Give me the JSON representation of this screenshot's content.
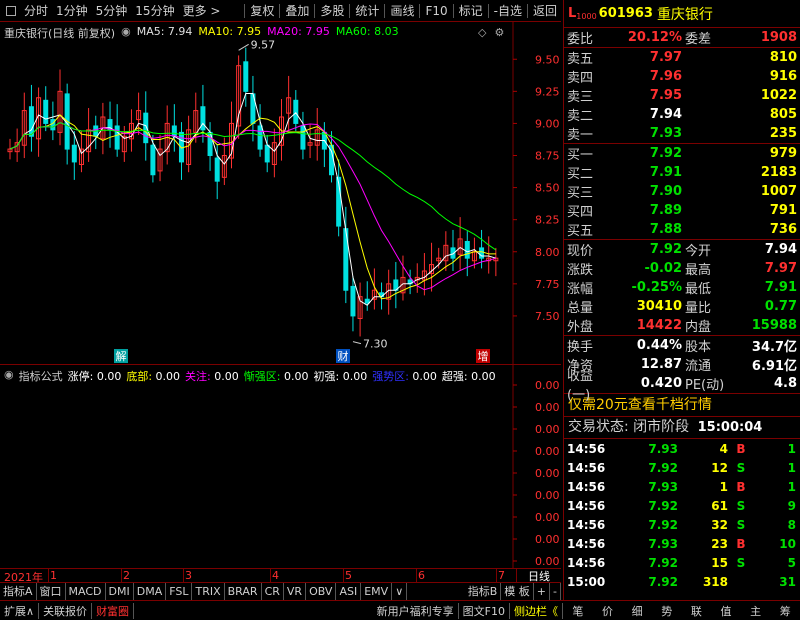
{
  "toolbar": {
    "items": [
      "分时",
      "1分钟",
      "5分钟",
      "15分钟",
      "更多 >"
    ],
    "right_items": [
      "复权",
      "叠加",
      "多股",
      "统计",
      "画线",
      "F10",
      "标记",
      "-自选",
      "返回"
    ]
  },
  "chart": {
    "stock_name": "重庆银行(日线 前复权)",
    "ma5": "MA5: 7.94",
    "ma10": "MA10: 7.95",
    "ma20": "MA20: 7.95",
    "ma60": "MA60: 8.03",
    "high_label": "9.57",
    "low_label": "7.30",
    "markers": [
      "解",
      "财",
      "增"
    ],
    "colors": {
      "up": "#ff3030",
      "down": "#00e0e0",
      "ma5": "#ffffff",
      "ma10": "#ffff00",
      "ma20": "#ff00ff",
      "ma60": "#00ff00"
    }
  },
  "chart_data": {
    "type": "candlestick",
    "y_ticks": [
      "9.50",
      "9.25",
      "9.00",
      "8.75",
      "8.50",
      "8.25",
      "8.00",
      "7.75",
      "7.50"
    ],
    "ylim": [
      7.25,
      9.65
    ],
    "closes": [
      8.8,
      8.85,
      9.1,
      8.9,
      9.2,
      9.0,
      8.95,
      9.25,
      8.8,
      8.7,
      8.8,
      8.95,
      8.9,
      9.05,
      8.95,
      8.8,
      8.9,
      9.0,
      9.1,
      8.85,
      8.6,
      8.8,
      9.0,
      8.9,
      8.7,
      8.95,
      9.1,
      8.95,
      8.75,
      8.55,
      8.75,
      9.0,
      9.45,
      9.25,
      9.0,
      8.8,
      8.7,
      8.85,
      9.05,
      9.2,
      9.0,
      8.8,
      8.85,
      8.95,
      8.8,
      8.6,
      8.2,
      7.7,
      7.5,
      7.65,
      7.6,
      7.7,
      7.65,
      7.75,
      7.7,
      7.8,
      7.75,
      7.8,
      7.85,
      7.9,
      7.95,
      8.05,
      7.95,
      8.1,
      7.95,
      8.0,
      7.95,
      7.95,
      7.95
    ],
    "volume_lower": {
      "y_ticks": [
        "0.00",
        "0.00",
        "0.00",
        "0.00",
        "0.00",
        "0.00",
        "0.00",
        "0.00",
        "0.00"
      ]
    }
  },
  "indicator": {
    "label": "指标公式",
    "items": [
      {
        "name": "涨停:",
        "value": "0.00",
        "color": "#ffffff"
      },
      {
        "name": "底部:",
        "value": "0.00",
        "color": "#ffff00"
      },
      {
        "name": "关注:",
        "value": "0.00",
        "color": "#ff00ff"
      },
      {
        "name": "惭强区:",
        "value": "0.00",
        "color": "#00ff00"
      },
      {
        "name": "初强:",
        "value": "0.00",
        "color": "#ffffff"
      },
      {
        "name": "强势区:",
        "value": "0.00",
        "color": "#3030ff"
      },
      {
        "name": "超强:",
        "value": "0.00",
        "color": "#ffffff"
      }
    ]
  },
  "time_axis": {
    "labels": [
      "2021年",
      "1",
      "2",
      "3",
      "4",
      "5",
      "6",
      "7"
    ],
    "day_label": "日线"
  },
  "ind_tabs": [
    "指标A",
    "窗口",
    "MACD",
    "DMI",
    "DMA",
    "FSL",
    "TRIX",
    "BRAR",
    "CR",
    "VR",
    "OBV",
    "ASI",
    "EMV",
    "∨",
    "指标B",
    "模 板",
    "+",
    "-"
  ],
  "bottom_bar": {
    "left": [
      "扩展∧",
      "关联报价",
      "财富圈"
    ],
    "mid": [
      "新用户福利专享",
      "图文F10",
      "侧边栏《"
    ],
    "right": [
      "笔",
      "价",
      "细",
      "势",
      "联",
      "值",
      "主",
      "筹"
    ]
  },
  "quote": {
    "prefix": "L",
    "prefix_sub": "1000",
    "code": "601963",
    "name": "重庆银行",
    "weibi_label": "委比",
    "weibi": "20.12%",
    "weicha_label": "委差",
    "weicha": "1908",
    "asks": [
      {
        "label": "卖五",
        "price": "7.97",
        "vol": "810",
        "color": "red"
      },
      {
        "label": "卖四",
        "price": "7.96",
        "vol": "916",
        "color": "red"
      },
      {
        "label": "卖三",
        "price": "7.95",
        "vol": "1022",
        "color": "red"
      },
      {
        "label": "卖二",
        "price": "7.94",
        "vol": "805",
        "color": "white"
      },
      {
        "label": "卖一",
        "price": "7.93",
        "vol": "235",
        "color": "green"
      }
    ],
    "bids": [
      {
        "label": "买一",
        "price": "7.92",
        "vol": "979",
        "color": "green"
      },
      {
        "label": "买二",
        "price": "7.91",
        "vol": "2183",
        "color": "green"
      },
      {
        "label": "买三",
        "price": "7.90",
        "vol": "1007",
        "color": "green"
      },
      {
        "label": "买四",
        "price": "7.89",
        "vol": "791",
        "color": "green"
      },
      {
        "label": "买五",
        "price": "7.88",
        "vol": "736",
        "color": "green"
      }
    ],
    "stats": [
      {
        "l1": "现价",
        "v1": "7.92",
        "c1": "green",
        "l2": "今开",
        "v2": "7.94",
        "c2": "white"
      },
      {
        "l1": "涨跌",
        "v1": "-0.02",
        "c1": "green",
        "l2": "最高",
        "v2": "7.97",
        "c2": "red"
      },
      {
        "l1": "涨幅",
        "v1": "-0.25%",
        "c1": "green",
        "l2": "最低",
        "v2": "7.91",
        "c2": "green"
      },
      {
        "l1": "总量",
        "v1": "30410",
        "c1": "yellow",
        "l2": "量比",
        "v2": "0.77",
        "c2": "green"
      },
      {
        "l1": "外盘",
        "v1": "14422",
        "c1": "red",
        "l2": "内盘",
        "v2": "15988",
        "c2": "green"
      }
    ],
    "fund": [
      {
        "l1": "换手",
        "v1": "0.44%",
        "l2": "股本",
        "v2": "34.7亿"
      },
      {
        "l1": "净资",
        "v1": "12.87",
        "l2": "流通",
        "v2": "6.91亿"
      },
      {
        "l1": "收益(一)",
        "v1": "0.420",
        "l2": "PE(动)",
        "v2": "4.8"
      }
    ],
    "promo": "仅需20元查看千档行情",
    "status_label": "交易状态: 闭市阶段",
    "status_time": "15:00:04",
    "ticks": [
      {
        "t": "14:56",
        "p": "7.93",
        "pc": "green",
        "v": "4",
        "bs": "B",
        "bsc": "red",
        "n": "1"
      },
      {
        "t": "14:56",
        "p": "7.92",
        "pc": "green",
        "v": "12",
        "bs": "S",
        "bsc": "green",
        "n": "1"
      },
      {
        "t": "14:56",
        "p": "7.93",
        "pc": "green",
        "v": "1",
        "bs": "B",
        "bsc": "red",
        "n": "1"
      },
      {
        "t": "14:56",
        "p": "7.92",
        "pc": "green",
        "v": "61",
        "bs": "S",
        "bsc": "green",
        "n": "9"
      },
      {
        "t": "14:56",
        "p": "7.92",
        "pc": "green",
        "v": "32",
        "bs": "S",
        "bsc": "green",
        "n": "8"
      },
      {
        "t": "14:56",
        "p": "7.93",
        "pc": "green",
        "v": "23",
        "bs": "B",
        "bsc": "red",
        "n": "10"
      },
      {
        "t": "14:56",
        "p": "7.92",
        "pc": "green",
        "v": "15",
        "bs": "S",
        "bsc": "green",
        "n": "5"
      },
      {
        "t": "15:00",
        "p": "7.92",
        "pc": "green",
        "v": "318",
        "bs": "",
        "bsc": "white",
        "n": "31"
      }
    ]
  }
}
